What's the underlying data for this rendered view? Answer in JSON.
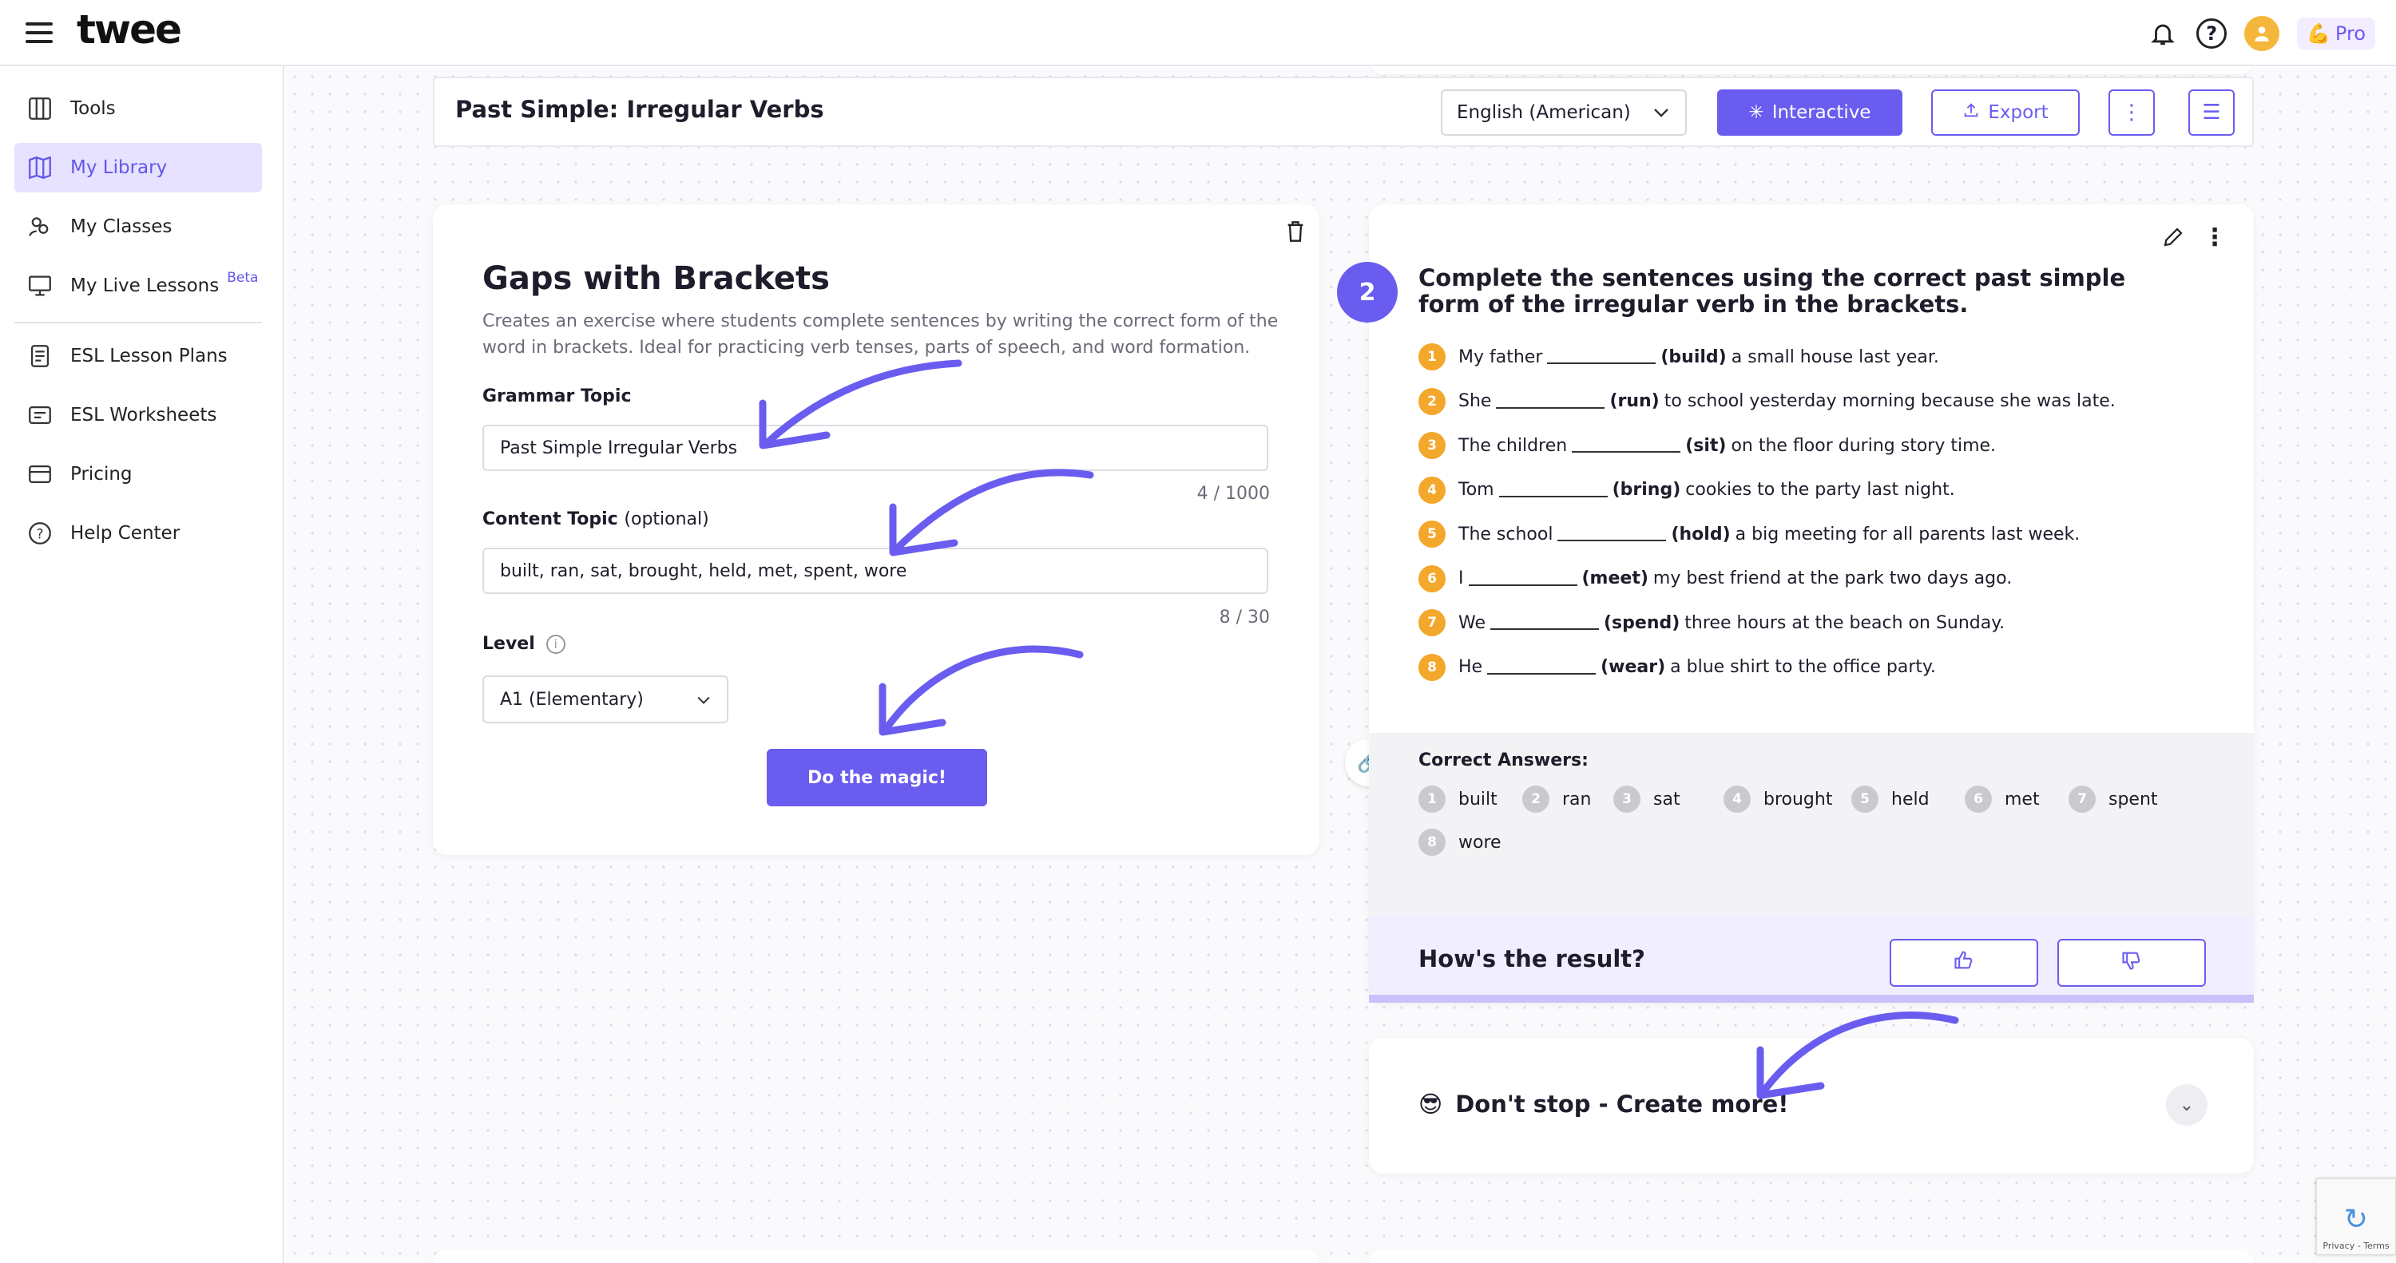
{
  "app": {
    "logo": "twee",
    "pro_label": "Pro",
    "pro_emoji": "💪"
  },
  "sidebar": {
    "items": [
      {
        "label": "Tools",
        "icon": "tools-icon"
      },
      {
        "label": "My Library",
        "icon": "library-icon"
      },
      {
        "label": "My Classes",
        "icon": "classes-icon"
      },
      {
        "label": "My Live Lessons",
        "icon": "live-lessons-icon",
        "badge": "Beta"
      },
      {
        "label": "ESL Lesson Plans",
        "icon": "lesson-plans-icon"
      },
      {
        "label": "ESL Worksheets",
        "icon": "worksheets-icon"
      },
      {
        "label": "Pricing",
        "icon": "pricing-icon"
      },
      {
        "label": "Help Center",
        "icon": "help-icon"
      }
    ]
  },
  "header": {
    "title": "Past Simple: Irregular Verbs",
    "language": "English (American)",
    "interactive_label": "Interactive",
    "export_label": "Export"
  },
  "generator": {
    "title": "Gaps with Brackets",
    "description": "Creates an exercise where students complete sentences by writing the correct form of the word in brackets. Ideal for practicing verb tenses, parts of speech, and word formation.",
    "grammar_label": "Grammar Topic",
    "grammar_value": "Past Simple Irregular Verbs",
    "grammar_count": "4 / 1000",
    "content_label": "Content Topic",
    "content_optional": "(optional)",
    "content_value": "built, ran, sat, brought, held, met, spent, wore",
    "content_count": "8 / 30",
    "level_label": "Level",
    "level_value": "A1 (Elementary)",
    "magic_label": "Do the magic!"
  },
  "exercise": {
    "number": "2",
    "title": "Complete the sentences using the correct past simple form of the irregular verb in the brackets.",
    "sentences": [
      {
        "n": "1",
        "pre": "My father",
        "verb": "(build)",
        "post": "a small house last year."
      },
      {
        "n": "2",
        "pre": "She",
        "verb": "(run)",
        "post": "to school yesterday morning because she was late."
      },
      {
        "n": "3",
        "pre": "The children",
        "verb": "(sit)",
        "post": "on the floor during story time."
      },
      {
        "n": "4",
        "pre": "Tom",
        "verb": "(bring)",
        "post": "cookies to the party last night."
      },
      {
        "n": "5",
        "pre": "The school",
        "verb": "(hold)",
        "post": "a big meeting for all parents last week."
      },
      {
        "n": "6",
        "pre": "I",
        "verb": "(meet)",
        "post": "my best friend at the park two days ago."
      },
      {
        "n": "7",
        "pre": "We",
        "verb": "(spend)",
        "post": "three hours at the beach on Sunday."
      },
      {
        "n": "8",
        "pre": "He",
        "verb": "(wear)",
        "post": "a blue shirt to the office party."
      }
    ],
    "answers_title": "Correct Answers:",
    "answers": [
      {
        "n": "1",
        "word": "built"
      },
      {
        "n": "2",
        "word": "ran"
      },
      {
        "n": "3",
        "word": "sat"
      },
      {
        "n": "4",
        "word": "brought"
      },
      {
        "n": "5",
        "word": "held"
      },
      {
        "n": "6",
        "word": "met"
      },
      {
        "n": "7",
        "word": "spent"
      },
      {
        "n": "8",
        "word": "wore"
      }
    ],
    "result_title": "How's the result?"
  },
  "more": {
    "emoji": "😎",
    "title": "Don't stop - Create more!"
  },
  "recaptcha": {
    "text": "Privacy - Terms"
  },
  "colors": {
    "accent": "#6b5cf0",
    "number_badge": "#f3a72b"
  }
}
